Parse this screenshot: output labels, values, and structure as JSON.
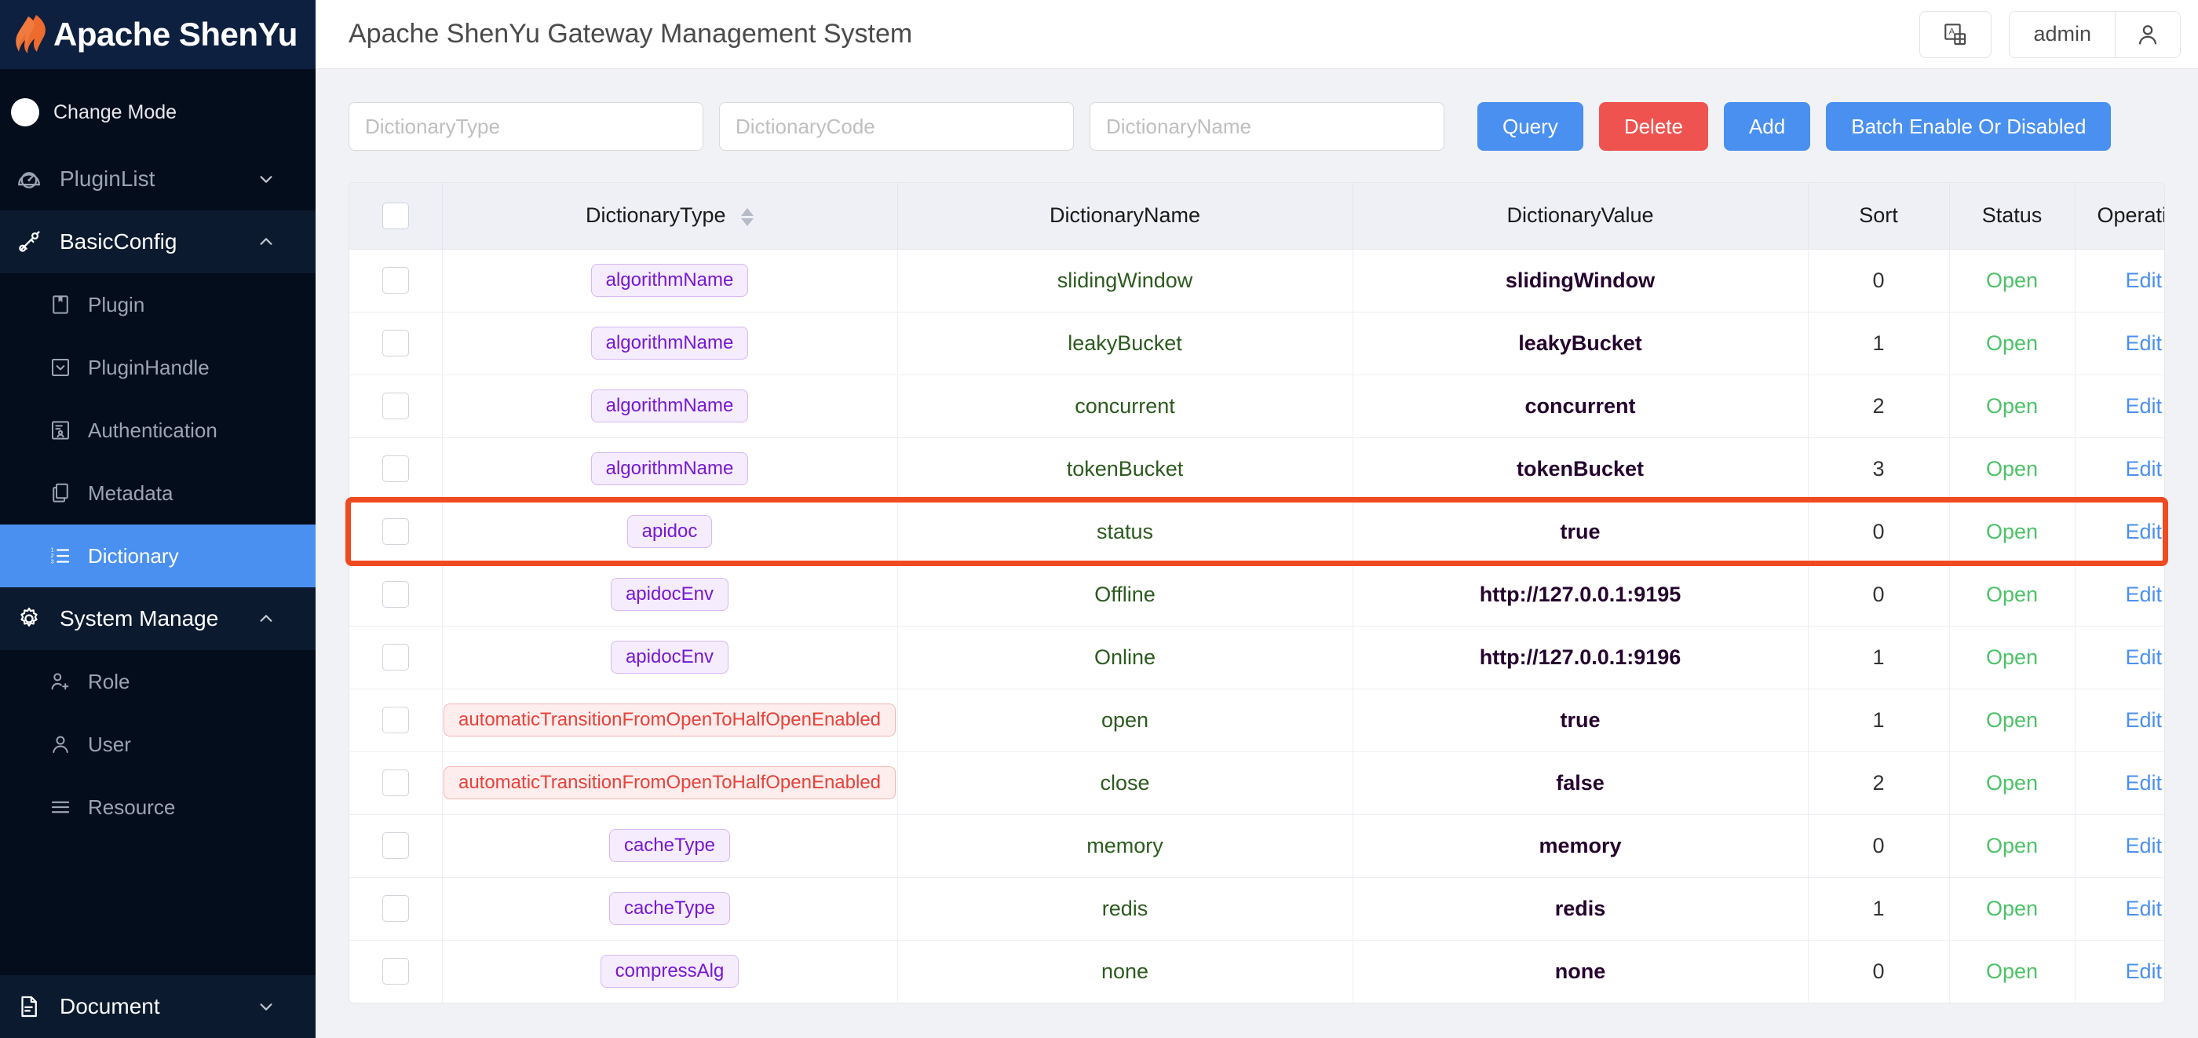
{
  "sidebar": {
    "brand": {
      "title": "Apache ShenYu",
      "logo_icon": "flame-logo-icon"
    },
    "change_mode": {
      "label": "Change Mode"
    },
    "groups": [
      {
        "label": "PluginList",
        "icon": "dashboard-icon",
        "arrow": "chevron-down-icon",
        "expanded": false,
        "items": []
      },
      {
        "label": "BasicConfig",
        "icon": "plug-icon",
        "arrow": "chevron-up-icon",
        "expanded": true,
        "items": [
          {
            "label": "Plugin",
            "icon": "book-icon",
            "active": false
          },
          {
            "label": "PluginHandle",
            "icon": "checkbox-square-icon",
            "active": false
          },
          {
            "label": "Authentication",
            "icon": "auth-card-icon",
            "active": false
          },
          {
            "label": "Metadata",
            "icon": "copy-icon",
            "active": false
          },
          {
            "label": "Dictionary",
            "icon": "ordered-list-icon",
            "active": true
          }
        ]
      },
      {
        "label": "System Manage",
        "icon": "gear-icon",
        "arrow": "chevron-up-icon",
        "expanded": true,
        "items": [
          {
            "label": "Role",
            "icon": "user-add-icon",
            "active": false
          },
          {
            "label": "User",
            "icon": "user-icon",
            "active": false
          },
          {
            "label": "Resource",
            "icon": "menu-lines-icon",
            "active": false
          }
        ]
      },
      {
        "label": "Document",
        "icon": "file-text-icon",
        "arrow": "chevron-down-icon",
        "expanded": false,
        "items": []
      }
    ]
  },
  "topbar": {
    "title": "Apache ShenYu Gateway Management System",
    "language_icon": "translate-icon",
    "user_name": "admin",
    "avatar_icon": "user-icon"
  },
  "filters": {
    "dictionary_type": {
      "placeholder": "DictionaryType",
      "value": ""
    },
    "dictionary_code": {
      "placeholder": "DictionaryCode",
      "value": ""
    },
    "dictionary_name": {
      "placeholder": "DictionaryName",
      "value": ""
    },
    "buttons": {
      "query": "Query",
      "delete": "Delete",
      "add": "Add",
      "batch": "Batch Enable Or Disabled"
    }
  },
  "table": {
    "columns": [
      {
        "key": "check",
        "label": ""
      },
      {
        "key": "type",
        "label": "DictionaryType",
        "sortable": true
      },
      {
        "key": "name",
        "label": "DictionaryName",
        "sortable": false
      },
      {
        "key": "value",
        "label": "DictionaryValue",
        "sortable": false
      },
      {
        "key": "sort",
        "label": "Sort",
        "sortable": false
      },
      {
        "key": "status",
        "label": "Status",
        "sortable": false
      },
      {
        "key": "operation",
        "label": "Operation",
        "sortable": false
      }
    ],
    "rows": [
      {
        "type": "algorithmName",
        "tag_color": "purple",
        "name": "slidingWindow",
        "value": "slidingWindow",
        "sort": "0",
        "status": "Open",
        "operation": "Edit",
        "highlighted": false
      },
      {
        "type": "algorithmName",
        "tag_color": "purple",
        "name": "leakyBucket",
        "value": "leakyBucket",
        "sort": "1",
        "status": "Open",
        "operation": "Edit",
        "highlighted": false
      },
      {
        "type": "algorithmName",
        "tag_color": "purple",
        "name": "concurrent",
        "value": "concurrent",
        "sort": "2",
        "status": "Open",
        "operation": "Edit",
        "highlighted": false
      },
      {
        "type": "algorithmName",
        "tag_color": "purple",
        "name": "tokenBucket",
        "value": "tokenBucket",
        "sort": "3",
        "status": "Open",
        "operation": "Edit",
        "highlighted": false
      },
      {
        "type": "apidoc",
        "tag_color": "purple",
        "name": "status",
        "value": "true",
        "sort": "0",
        "status": "Open",
        "operation": "Edit",
        "highlighted": true
      },
      {
        "type": "apidocEnv",
        "tag_color": "purple",
        "name": "Offline",
        "value": "http://127.0.0.1:9195",
        "sort": "0",
        "status": "Open",
        "operation": "Edit",
        "highlighted": false
      },
      {
        "type": "apidocEnv",
        "tag_color": "purple",
        "name": "Online",
        "value": "http://127.0.0.1:9196",
        "sort": "1",
        "status": "Open",
        "operation": "Edit",
        "highlighted": false
      },
      {
        "type": "automaticTransitionFromOpenToHalfOpenEnabled",
        "tag_color": "red",
        "name": "open",
        "value": "true",
        "sort": "1",
        "status": "Open",
        "operation": "Edit",
        "highlighted": false
      },
      {
        "type": "automaticTransitionFromOpenToHalfOpenEnabled",
        "tag_color": "red",
        "name": "close",
        "value": "false",
        "sort": "2",
        "status": "Open",
        "operation": "Edit",
        "highlighted": false
      },
      {
        "type": "cacheType",
        "tag_color": "purple",
        "name": "memory",
        "value": "memory",
        "sort": "0",
        "status": "Open",
        "operation": "Edit",
        "highlighted": false
      },
      {
        "type": "cacheType",
        "tag_color": "purple",
        "name": "redis",
        "value": "redis",
        "sort": "1",
        "status": "Open",
        "operation": "Edit",
        "highlighted": false
      },
      {
        "type": "compressAlg",
        "tag_color": "purple",
        "name": "none",
        "value": "none",
        "sort": "0",
        "status": "Open",
        "operation": "Edit",
        "highlighted": false
      }
    ]
  },
  "colors": {
    "sidebar_bg": "#030d1c",
    "brand_bg": "#0e2040",
    "accent_blue": "#4a90f0",
    "danger_red": "#ef5350",
    "status_green": "#4cc268",
    "highlight_orange": "#f04a20",
    "tag_purple_text": "#7618d1",
    "tag_red_text": "#e8413a"
  }
}
